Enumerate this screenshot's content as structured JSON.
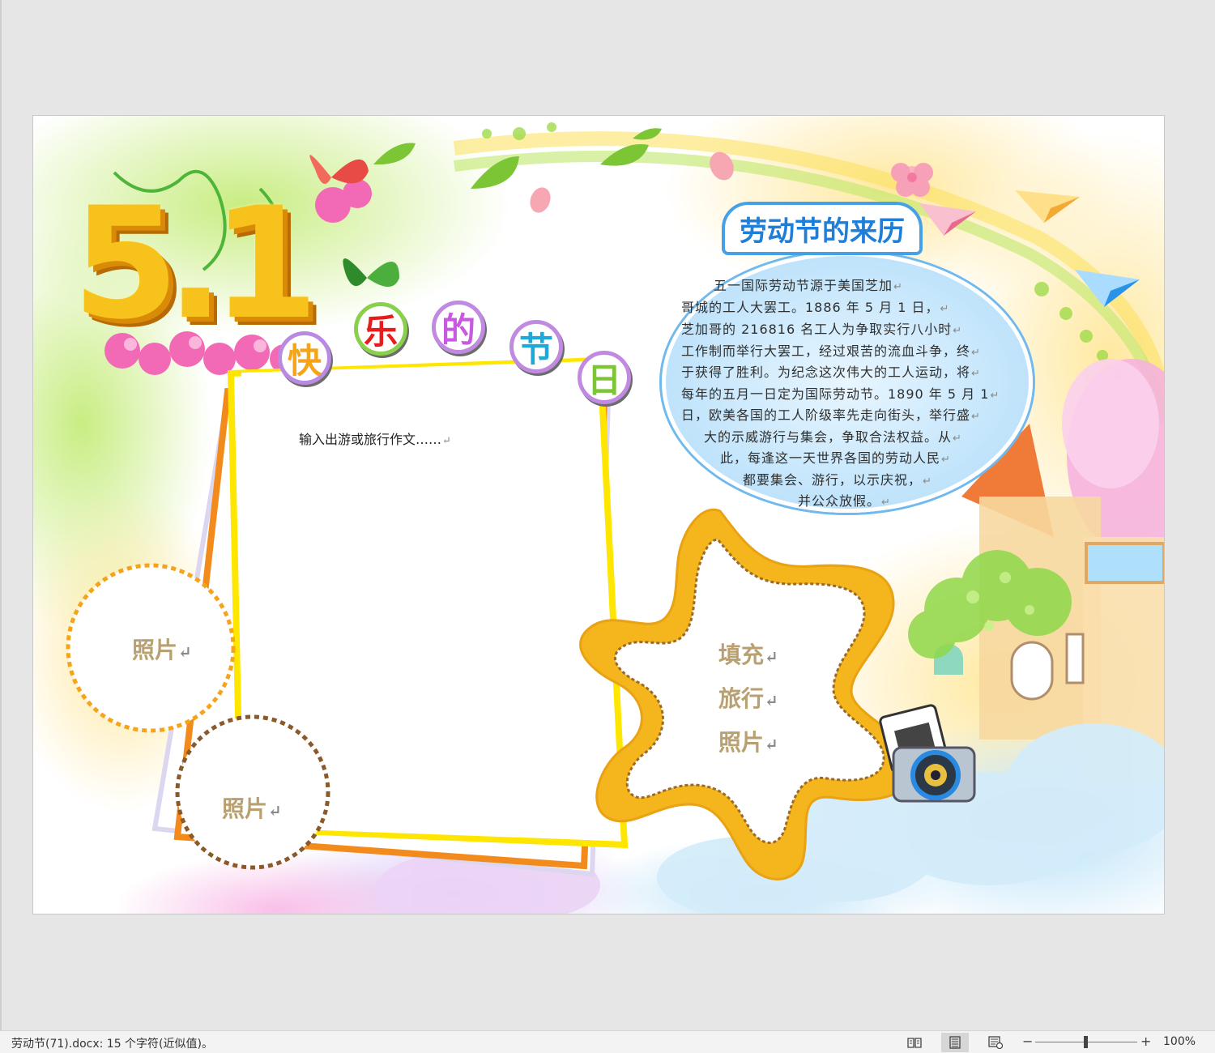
{
  "document": {
    "big_number": "5.1",
    "title_chars": [
      "快",
      "乐",
      "的",
      "节",
      "日"
    ],
    "history": {
      "title": "劳动节的来历",
      "lines": [
        "五一国际劳动节源于美国芝加",
        "哥城的工人大罢工。1886 年 5 月 1 日，",
        "芝加哥的 216816 名工人为争取实行八小时",
        "工作制而举行大罢工，经过艰苦的流血斗争，终",
        "于获得了胜利。为纪念这次伟大的工人运动，将",
        "每年的五月一日定为国际劳动节。1890 年 5 月 1",
        "日，欧美各国的工人阶级率先走向街头，举行盛",
        "大的示威游行与集会，争取合法权益。从",
        "此，每逢这一天世界各国的劳动人民",
        "都要集会、游行，以示庆祝，",
        "并公众放假。"
      ]
    },
    "essay_prompt": "输入出游或旅行作文……",
    "photo_left_top": "照片",
    "photo_left_bottom": "照片",
    "flower_lines": [
      "填充",
      "旅行",
      "照片"
    ]
  },
  "status_bar": {
    "doc_info": "劳动节(71).docx: 15 个字符(近似值)。",
    "zoom_minus": "−",
    "zoom_plus": "+",
    "zoom_percent": "100%"
  },
  "icons": {
    "return_mark": "↵",
    "read_mode": "read-mode-icon",
    "print_layout": "print-layout-icon",
    "web_layout": "web-layout-icon"
  },
  "colors": {
    "title_blue": "#1f7fd8",
    "essay_frame_yellow": "#ffe600",
    "flower_orange": "#f5b51c",
    "photo_label": "#b8a070"
  }
}
